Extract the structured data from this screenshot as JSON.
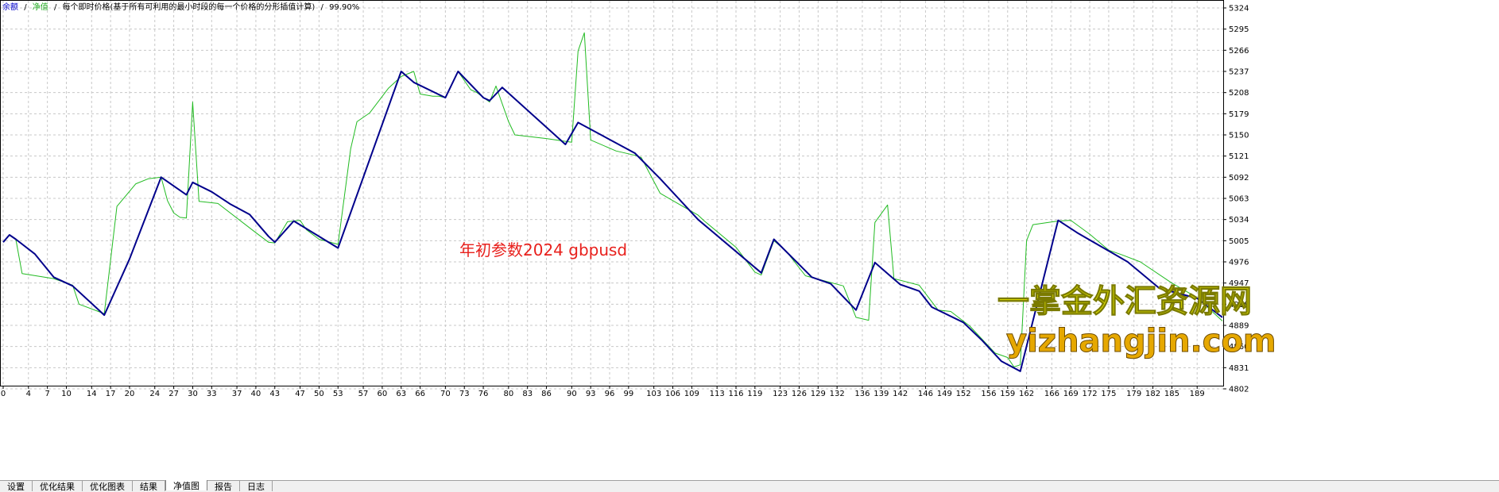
{
  "legend": {
    "balance_label": "余额",
    "equity_label": "净值",
    "model_text": "每个即时价格(基于所有可利用的最小时段的每一个价格的分形插值计算)",
    "quality_text": "99.90%",
    "separator": "/"
  },
  "annotation": "年初参数2024 gbpusd",
  "watermark": {
    "line1": "一掌金外汇资源网",
    "line2": "yizhangjin.com"
  },
  "colors": {
    "balance": "#00008b",
    "equity": "#22bb22",
    "grid": "#c8c8c8",
    "annotation": "#e8201c"
  },
  "tabs": [
    {
      "label": "设置",
      "active": false
    },
    {
      "label": "优化结果",
      "active": false
    },
    {
      "label": "优化图表",
      "active": false
    },
    {
      "label": "结果",
      "active": false
    },
    {
      "label": "净值图",
      "active": true
    },
    {
      "label": "报告",
      "active": false
    },
    {
      "label": "日志",
      "active": false
    }
  ],
  "chart_data": {
    "type": "line",
    "title": "",
    "xlabel": "",
    "ylabel": "",
    "xlim": [
      0,
      193
    ],
    "ylim": [
      4802,
      5324
    ],
    "x_ticks": [
      0,
      4,
      7,
      10,
      14,
      17,
      20,
      24,
      27,
      30,
      33,
      37,
      40,
      43,
      47,
      50,
      53,
      57,
      60,
      63,
      66,
      70,
      73,
      76,
      80,
      83,
      86,
      90,
      93,
      96,
      99,
      103,
      106,
      109,
      113,
      116,
      119,
      123,
      126,
      129,
      132,
      136,
      139,
      142,
      146,
      149,
      152,
      156,
      159,
      162,
      166,
      169,
      172,
      175,
      179,
      182,
      185,
      189
    ],
    "y_ticks": [
      5324,
      5295,
      5266,
      5237,
      5208,
      5179,
      5150,
      5121,
      5092,
      5063,
      5034,
      5005,
      4976,
      4947,
      4918,
      4889,
      4860,
      4831,
      4802
    ],
    "grid": true,
    "legend_position": "top-left",
    "series": [
      {
        "name": "余额",
        "color": "#00008b",
        "x": [
          0,
          1,
          2,
          5,
          8,
          11,
          16,
          20,
          25,
          29,
          30,
          33,
          36,
          39,
          42,
          43,
          46,
          53,
          63,
          65,
          70,
          72,
          76,
          77,
          79,
          89,
          91,
          100,
          104,
          110,
          120,
          122,
          128,
          131,
          135,
          138,
          140,
          142,
          145,
          147,
          152,
          155,
          158,
          161,
          167,
          170,
          174,
          178,
          183,
          189,
          193
        ],
        "y": [
          5003,
          5013,
          5007,
          4987,
          4955,
          4943,
          4903,
          4980,
          5092,
          5068,
          5085,
          5072,
          5055,
          5041,
          5011,
          5003,
          5032,
          4995,
          5237,
          5222,
          5201,
          5237,
          5201,
          5197,
          5215,
          5137,
          5167,
          5125,
          5090,
          5034,
          4961,
          5007,
          4955,
          4946,
          4910,
          4975,
          4960,
          4945,
          4936,
          4914,
          4893,
          4868,
          4840,
          4826,
          5033,
          5016,
          4996,
          4976,
          4940,
          4926,
          4900
        ]
      },
      {
        "name": "净值",
        "color": "#22bb22",
        "x": [
          0,
          1,
          2,
          3,
          8,
          11,
          12,
          16,
          18,
          21,
          23,
          25,
          26,
          27,
          28,
          29,
          30,
          31,
          34,
          40,
          42,
          43,
          45,
          47,
          48,
          50,
          53,
          55,
          56,
          58,
          61,
          63,
          65,
          66,
          68,
          69,
          70,
          72,
          74,
          75,
          77,
          78,
          80,
          81,
          86,
          90,
          91,
          92,
          93,
          97,
          100,
          101,
          104,
          106,
          110,
          111,
          116,
          119,
          120,
          122,
          124,
          127,
          133,
          135,
          137,
          138,
          140,
          141,
          145,
          148,
          150,
          153,
          157,
          159,
          160,
          161,
          162,
          163,
          167,
          169,
          172,
          175,
          177,
          180,
          185,
          189,
          193
        ],
        "y": [
          5003,
          5013,
          5007,
          4960,
          4953,
          4944,
          4918,
          4905,
          5052,
          5083,
          5090,
          5092,
          5060,
          5043,
          5037,
          5036,
          5195,
          5059,
          5056,
          5016,
          5003,
          5002,
          5031,
          5033,
          5020,
          5007,
          5000,
          5131,
          5168,
          5180,
          5214,
          5230,
          5237,
          5206,
          5203,
          5203,
          5201,
          5237,
          5212,
          5208,
          5195,
          5217,
          5168,
          5150,
          5145,
          5140,
          5265,
          5290,
          5143,
          5128,
          5122,
          5119,
          5070,
          5060,
          5040,
          5032,
          4996,
          4962,
          4958,
          5005,
          4990,
          4957,
          4943,
          4900,
          4896,
          5030,
          5054,
          4953,
          4944,
          4910,
          4908,
          4888,
          4851,
          4845,
          4832,
          4835,
          5005,
          5027,
          5032,
          5033,
          5014,
          4992,
          4986,
          4976,
          4947,
          4927,
          4895
        ]
      }
    ],
    "annotations": [
      "年初参数2024 gbpusd"
    ]
  }
}
